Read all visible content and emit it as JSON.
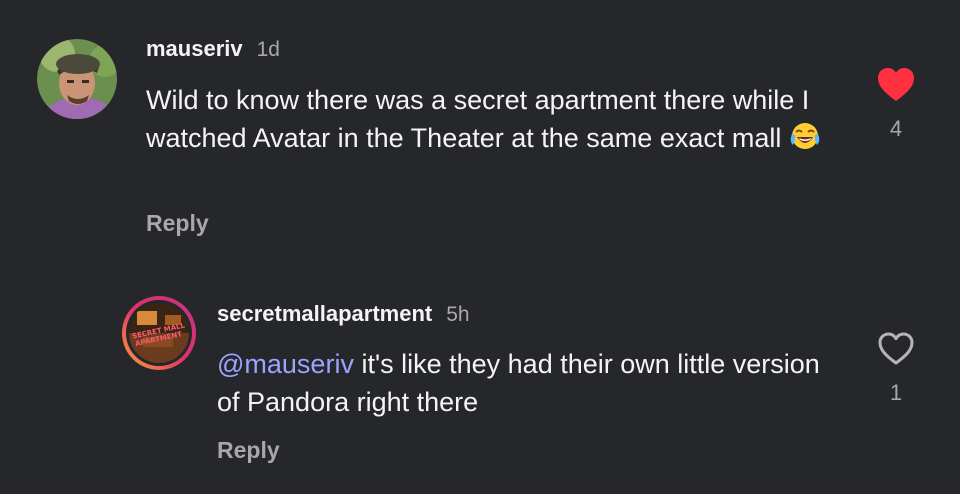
{
  "comments": [
    {
      "username": "mauseriv",
      "time": "1d",
      "text": "Wild to know there was a secret apartment there while I watched Avatar in the Theater at the same exact mall",
      "emoji": "face-with-tears-of-joy",
      "reply_label": "Reply",
      "likes": "4",
      "liked": true,
      "like_color": "#ff3040"
    },
    {
      "username": "secretmallapartment",
      "time": "5h",
      "mention": "@mauseriv",
      "text": " it's like they had their own little version of Pandora right there",
      "reply_label": "Reply",
      "likes": "1",
      "liked": false,
      "avatar_text": "SECRET MALL APARTMENT",
      "mention_color": "#9ca3ff"
    }
  ]
}
